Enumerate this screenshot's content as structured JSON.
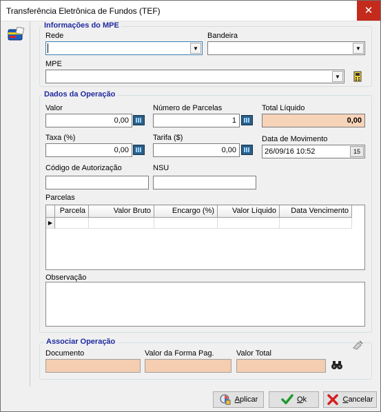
{
  "window": {
    "title": "Transferência Eletrônica de Fundos (TEF)",
    "close_symbol": "✕"
  },
  "info_mpe": {
    "title": "Informações do MPE",
    "rede_label": "Rede",
    "rede_value": "",
    "bandeira_label": "Bandeira",
    "bandeira_value": "",
    "mpe_label": "MPE",
    "mpe_value": ""
  },
  "operacao": {
    "title": "Dados da Operação",
    "valor_label": "Valor",
    "valor_value": "0,00",
    "num_parcelas_label": "Número de Parcelas",
    "num_parcelas_value": "1",
    "total_liquido_label": "Total Líquido",
    "total_liquido_value": "0,00",
    "taxa_label": "Taxa (%)",
    "taxa_value": "0,00",
    "tarifa_label": "Tarifa ($)",
    "tarifa_value": "0,00",
    "data_mov_label": "Data de Movimento",
    "data_mov_value": "26/09/16 10:52",
    "cod_aut_label": "Código de Autorização",
    "cod_aut_value": "",
    "nsu_label": "NSU",
    "nsu_value": "",
    "parcelas_label": "Parcelas",
    "parcelas_columns": [
      "Parcela",
      "Valor Bruto",
      "Encargo (%)",
      "Valor Líquido",
      "Data Vencimento"
    ],
    "row_indicator": "▶",
    "observacao_label": "Observação",
    "observacao_value": ""
  },
  "associar": {
    "title": "Associar Operação",
    "documento_label": "Documento",
    "documento_value": "",
    "valor_forma_label": "Valor da Forma Pag.",
    "valor_forma_value": "",
    "valor_total_label": "Valor Total",
    "valor_total_value": ""
  },
  "buttons": {
    "aplicar_first": "A",
    "aplicar_rest": "plicar",
    "ok_first": "O",
    "ok_rest": "k",
    "cancelar_first": "C",
    "cancelar_rest": "ancelar"
  },
  "colors": {
    "accent_title": "#1f2aa0",
    "readonly_fill": "#f7d3b8",
    "close_red": "#c42b1c"
  }
}
